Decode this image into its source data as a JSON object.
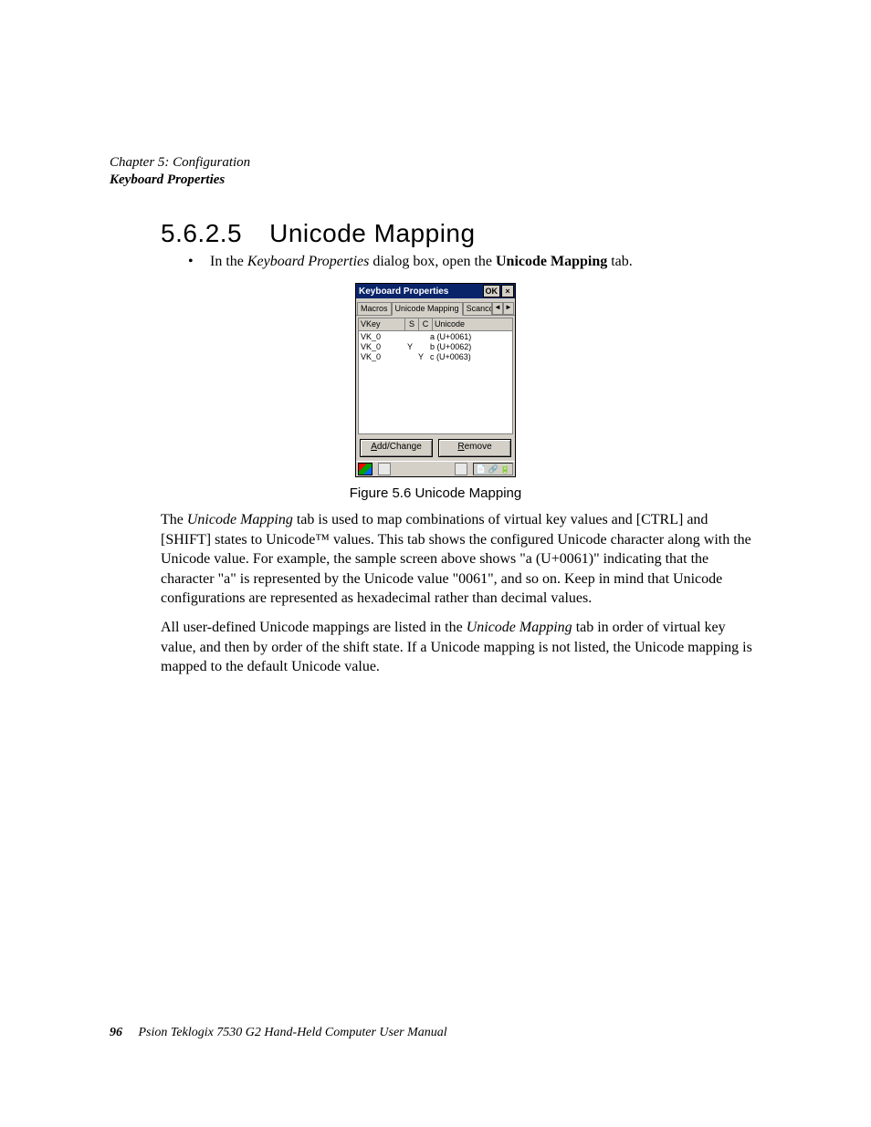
{
  "header": {
    "chapter": "Chapter 5: Configuration",
    "section": "Keyboard Properties"
  },
  "heading": {
    "number": "5.6.2.5",
    "title": "Unicode Mapping"
  },
  "bullet": {
    "pre": "In the ",
    "italic": "Keyboard Properties",
    "mid": " dialog box, open the ",
    "bold": "Unicode Mapping",
    "post": " tab."
  },
  "screenshot": {
    "title": "Keyboard Properties",
    "ok": "OK",
    "close": "×",
    "tabs": {
      "macros": "Macros",
      "unicode": "Unicode Mapping",
      "scancode": "Scanco",
      "left_arrow": "◄",
      "right_arrow": "►"
    },
    "columns": {
      "vkey": "VKey",
      "s": "S",
      "c": "C",
      "unicode": "Unicode"
    },
    "rows": [
      {
        "vkey": "VK_0",
        "s": "",
        "c": "",
        "unicode": "a (U+0061)"
      },
      {
        "vkey": "VK_0",
        "s": "Y",
        "c": "",
        "unicode": "b (U+0062)"
      },
      {
        "vkey": "VK_0",
        "s": "",
        "c": "Y",
        "unicode": "c (U+0063)"
      }
    ],
    "buttons": {
      "add_change_u": "A",
      "add_change_rest": "dd/Change",
      "remove_u": "R",
      "remove_rest": "emove"
    }
  },
  "figure_caption": "Figure 5.6 Unicode Mapping",
  "para1": {
    "a": "The ",
    "i1": "Unicode Mapping",
    "b": " tab is used to map combinations of virtual key values and [CTRL] and [SHIFT] states to Unicode™ values. This tab shows the configured Unicode character along with the Unicode value. For example, the sample screen above shows \"a (U+0061)\" indicating that the character \"a\" is represented by the Unicode value \"0061\", and so on. Keep in mind that Unicode configurations are represented as hexadecimal rather than decimal values."
  },
  "para2": {
    "a": "All user-defined Unicode mappings are listed in the ",
    "i1": "Unicode Mapping",
    "b": " tab in order of virtual key value, and then by order of the shift state. If a Unicode mapping is not listed, the Unicode mapping is mapped to the default Unicode value."
  },
  "footer": {
    "page": "96",
    "text": "Psion Teklogix 7530 G2 Hand-Held Computer User Manual"
  }
}
